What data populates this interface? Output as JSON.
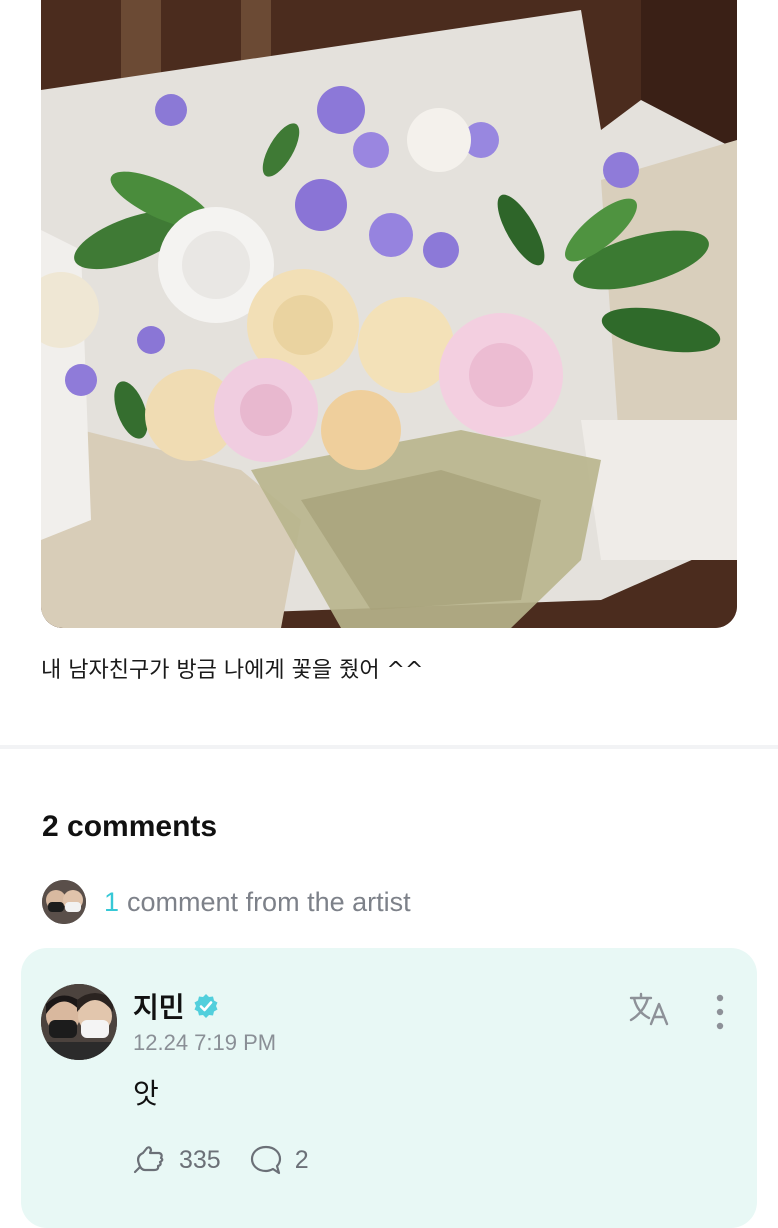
{
  "post": {
    "caption": "내 남자친구가 방금 나에게 꽃을 줬어 ^^"
  },
  "comments_section": {
    "title": "2 comments",
    "artist_count": "1",
    "artist_label": "comment from the artist"
  },
  "comment": {
    "author": "지민",
    "timestamp": "12.24 7:19 PM",
    "text": "앗",
    "like_count": "335",
    "reply_count": "2",
    "icons": [
      "verified-badge-icon",
      "translate-icon",
      "more-options-icon",
      "cheer-icon",
      "reply-icon"
    ]
  },
  "colors": {
    "accent": "#36c8d6",
    "card_bg": "#e8f8f5",
    "muted": "#7d8189"
  }
}
